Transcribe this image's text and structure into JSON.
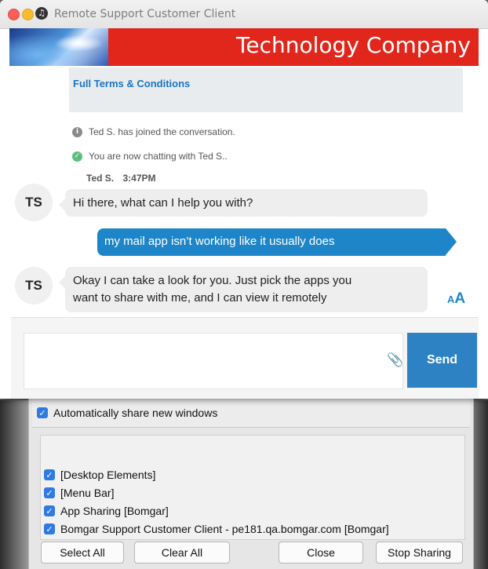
{
  "window": {
    "title": "Remote Support Customer Client",
    "app_icon_glyph": "♫",
    "controls": [
      "close",
      "minimize"
    ]
  },
  "banner": {
    "company": "Technology Company",
    "logo_icon": "brand-logo-image"
  },
  "terms": {
    "link_text": "Full Terms & Conditions"
  },
  "system_messages": [
    {
      "icon": "info-icon",
      "glyph": "i",
      "text": "Ted S. has joined the conversation."
    },
    {
      "icon": "check-icon",
      "glyph": "✓",
      "text": "You are now chatting with Ted S.."
    }
  ],
  "message_meta": {
    "sender": "Ted S.",
    "time": "3:47PM"
  },
  "messages": [
    {
      "direction": "in",
      "avatar": "TS",
      "text": "Hi there, what can I help you with?"
    },
    {
      "direction": "out",
      "text": "my mail app isn’t working like it usually does"
    },
    {
      "direction": "in",
      "avatar": "TS",
      "lines": [
        "Okay I can take a look for you.  Just pick the apps you",
        "want to share with me, and I can view it remotely"
      ]
    }
  ],
  "font_toggle": {
    "small": "A",
    "large": "A"
  },
  "composer": {
    "placeholder": "",
    "send_label": "Send",
    "attach_icon": "paperclip-icon",
    "attach_glyph": "✂"
  },
  "sharing": {
    "auto_share_label": "Automatically share new windows",
    "items": [
      "[Desktop Elements]",
      "[Menu Bar]",
      "App Sharing [Bomgar]",
      "Bomgar Support Customer Client - pe181.qa.bomgar.com [Bomgar]"
    ],
    "buttons": {
      "select_all": "Select All",
      "clear_all": "Clear All",
      "close": "Close",
      "stop_sharing": "Stop Sharing"
    }
  },
  "colors": {
    "banner_red": "#e1261c",
    "accent_blue": "#1e86c8",
    "send_blue": "#2d82c4",
    "checkbox_blue": "#2f7ae5"
  }
}
